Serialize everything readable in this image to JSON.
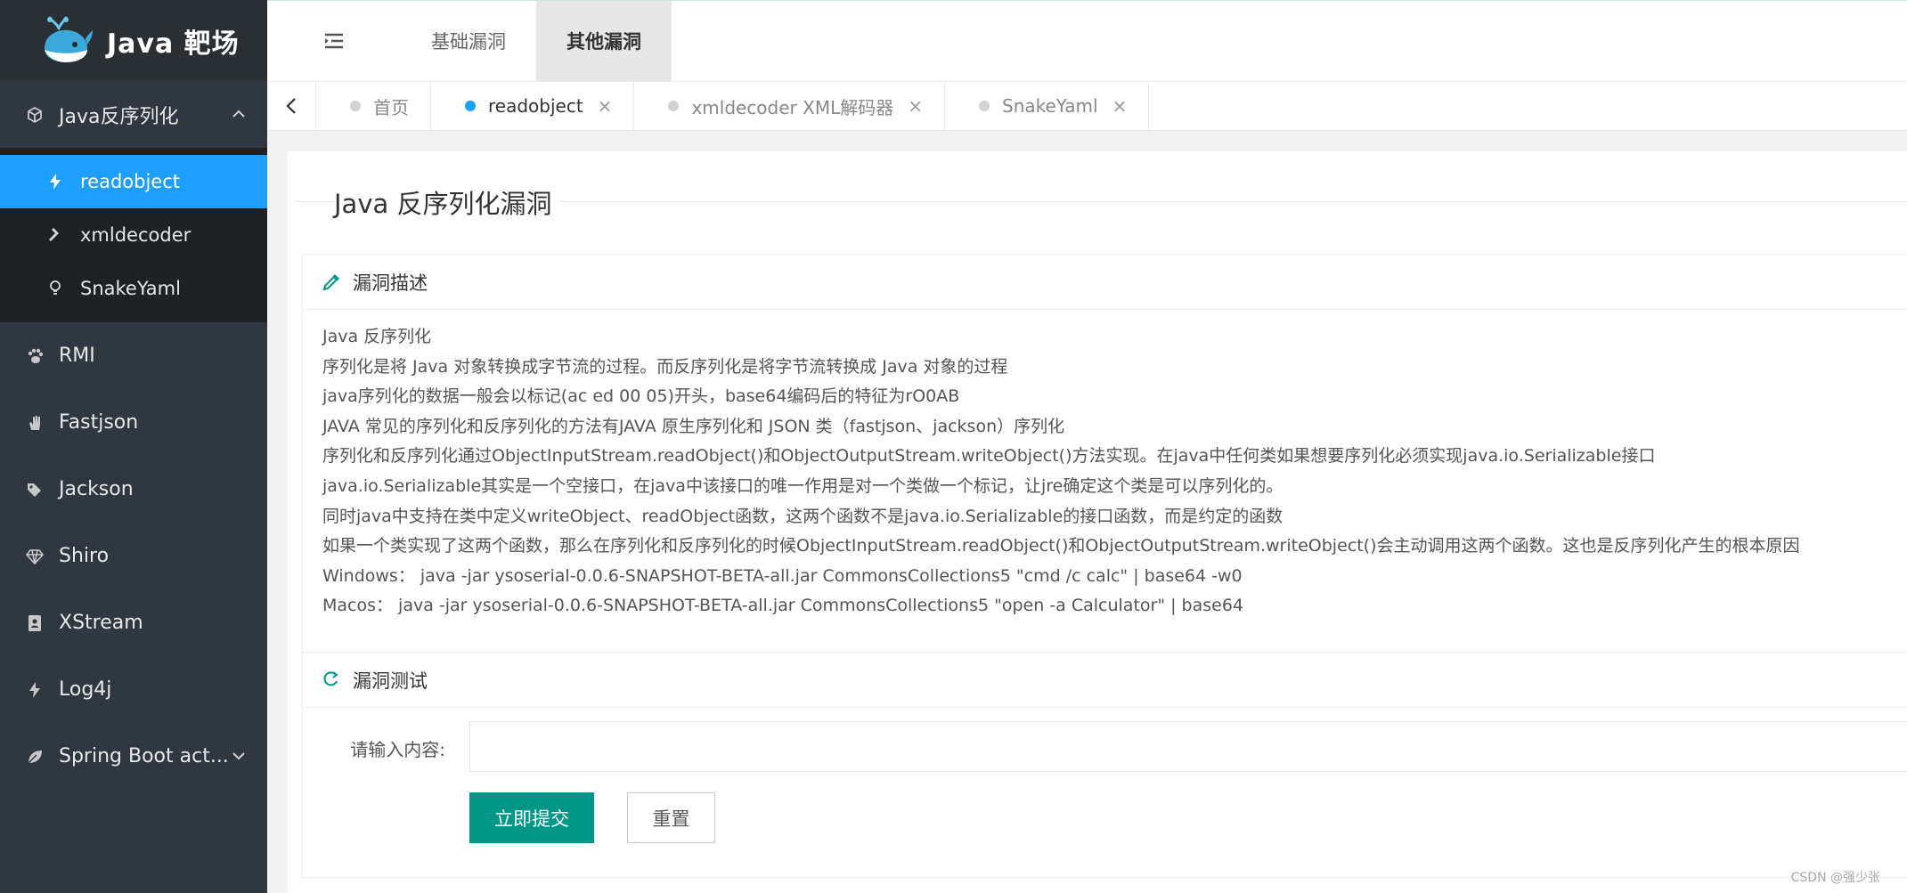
{
  "app": {
    "title": "Java 靶场"
  },
  "sidebar": {
    "group": {
      "label": "Java反序列化",
      "icon": "cube-icon",
      "children": [
        {
          "label": "readobject",
          "icon": "bolt-icon",
          "active": true
        },
        {
          "label": "xmldecoder",
          "icon": "hammer-icon",
          "active": false
        },
        {
          "label": "SnakeYaml",
          "icon": "bulb-icon",
          "active": false
        }
      ]
    },
    "items": [
      {
        "label": "RMI",
        "icon": "paw-icon"
      },
      {
        "label": "Fastjson",
        "icon": "hand-icon"
      },
      {
        "label": "Jackson",
        "icon": "tags-icon"
      },
      {
        "label": "Shiro",
        "icon": "diamond-icon"
      },
      {
        "label": "XStream",
        "icon": "contact-book-icon"
      },
      {
        "label": "Log4j",
        "icon": "bolt-icon"
      },
      {
        "label": "Spring Boot act...",
        "icon": "leaf-icon"
      }
    ],
    "colors": {
      "bg": "#2f3740",
      "active": "#1e9fff",
      "submenu_bg": "#1e2225"
    }
  },
  "header": {
    "tabs": [
      {
        "label": "基础漏洞",
        "active": false
      },
      {
        "label": "其他漏洞",
        "active": true
      }
    ]
  },
  "tabbar": {
    "tabs": [
      {
        "label": "首页",
        "closable": false,
        "active": false
      },
      {
        "label": "readobject",
        "closable": true,
        "active": true
      },
      {
        "label": "xmldecoder XML解码器",
        "closable": true,
        "active": false
      },
      {
        "label": "SnakeYaml",
        "closable": true,
        "active": false
      }
    ],
    "close_glyph": "×"
  },
  "main": {
    "title": "Java 反序列化漏洞",
    "description": {
      "heading": "漏洞描述",
      "lines": [
        "Java 反序列化",
        "序列化是将 Java 对象转换成字节流的过程。而反序列化是将字节流转换成 Java 对象的过程",
        "java序列化的数据一般会以标记(ac ed 00 05)开头，base64编码后的特征为rO0AB",
        "JAVA 常见的序列化和反序列化的方法有JAVA 原生序列化和 JSON 类（fastjson、jackson）序列化",
        "序列化和反序列化通过ObjectInputStream.readObject()和ObjectOutputStream.writeObject()方法实现。在java中任何类如果想要序列化必须实现java.io.Serializable接口",
        "java.io.Serializable其实是一个空接口，在java中该接口的唯一作用是对一个类做一个标记，让jre确定这个类是可以序列化的。",
        "同时java中支持在类中定义writeObject、readObject函数，这两个函数不是java.io.Serializable的接口函数，而是约定的函数",
        "如果一个类实现了这两个函数，那么在序列化和反序列化的时候ObjectInputStream.readObject()和ObjectOutputStream.writeObject()会主动调用这两个函数。这也是反序列化产生的根本原因",
        "Windows：  java -jar ysoserial-0.0.6-SNAPSHOT-BETA-all.jar CommonsCollections5 \"cmd /c calc\" | base64 -w0",
        "Macos：  java -jar ysoserial-0.0.6-SNAPSHOT-BETA-all.jar CommonsCollections5 \"open -a Calculator\" | base64"
      ]
    },
    "test": {
      "heading": "漏洞测试",
      "input_label": "请输入内容:",
      "input_value": "",
      "submit_label": "立即提交",
      "reset_label": "重置"
    }
  },
  "watermark": "CSDN @强少张",
  "colors": {
    "primary": "#009688",
    "accent": "#1e9fff"
  }
}
